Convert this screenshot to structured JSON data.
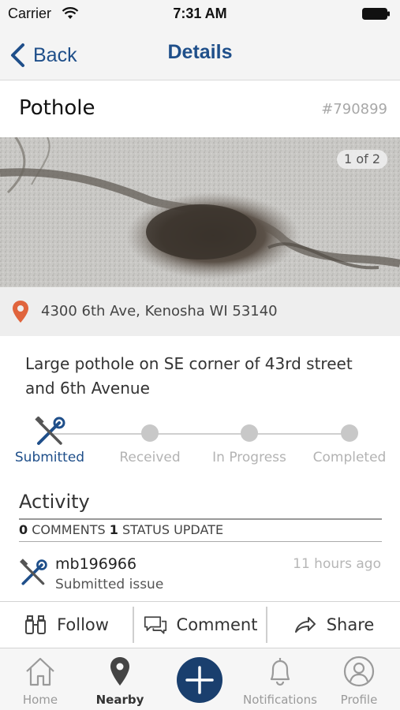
{
  "status_bar": {
    "carrier": "Carrier",
    "time": "7:31 AM"
  },
  "nav": {
    "back_label": "Back",
    "title": "Details"
  },
  "issue": {
    "title": "Pothole",
    "id": "#790899",
    "photo_counter": "1 of 2",
    "address": "4300 6th Ave, Kenosha WI 53140",
    "description": "Large pothole on SE corner of 43rd street and 6th Avenue"
  },
  "progress": {
    "steps": [
      {
        "label": "Submitted",
        "active": true
      },
      {
        "label": "Received",
        "active": false
      },
      {
        "label": "In Progress",
        "active": false
      },
      {
        "label": "Completed",
        "active": false
      }
    ]
  },
  "activity": {
    "heading": "Activity",
    "comments_count": "0",
    "comments_label": "COMMENTS",
    "status_count": "1",
    "status_label": "STATUS UPDATE",
    "items": [
      {
        "user": "mb196966",
        "text": "Submitted issue",
        "time": "11 hours ago",
        "icon": "tools-icon"
      }
    ]
  },
  "actions": {
    "follow": "Follow",
    "comment": "Comment",
    "share": "Share"
  },
  "tabs": {
    "home": "Home",
    "nearby": "Nearby",
    "notifications": "Notifications",
    "profile": "Profile"
  },
  "colors": {
    "accent": "#1f4f8a",
    "fab": "#1a3f6e",
    "pin": "#e0643c"
  }
}
